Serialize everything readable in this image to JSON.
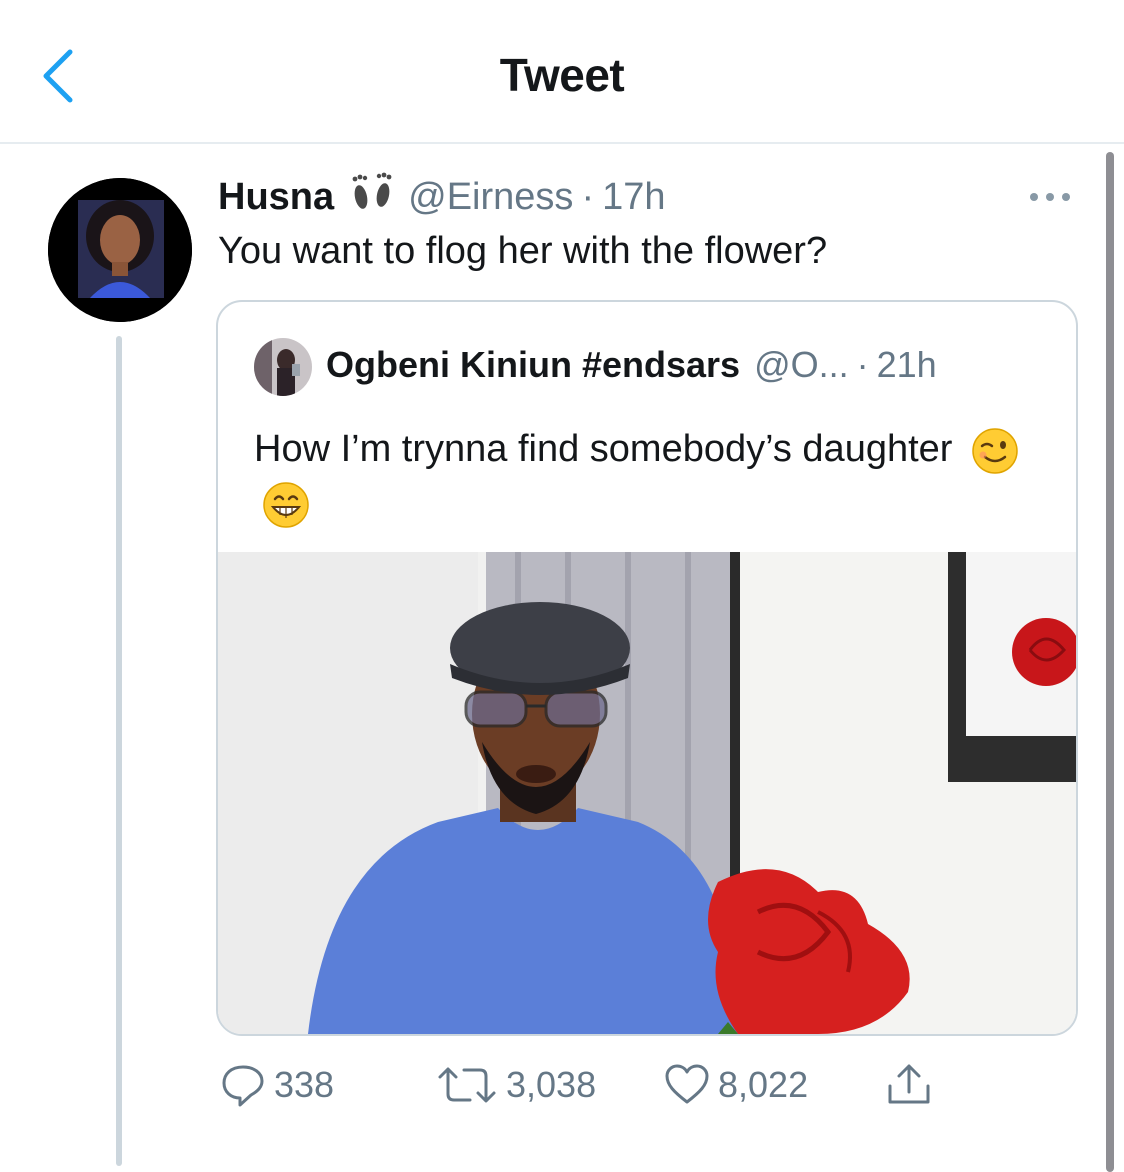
{
  "header": {
    "title": "Tweet"
  },
  "tweet": {
    "name": "Husna",
    "handle": "@Eirness",
    "separator": "·",
    "time": "17h",
    "text": "You want to flog her with the flower?",
    "name_emoji_icon": "footprints-icon"
  },
  "quote": {
    "name": "Ogbeni Kiniun #endsars",
    "handle": "@O...",
    "separator": "·",
    "time": "21h",
    "text": "How I’m trynna find somebody’s daughter",
    "emojis": [
      "winking-face-icon",
      "grinning-face-icon"
    ]
  },
  "actions": {
    "replies": "338",
    "retweets": "3,038",
    "likes": "8,022"
  },
  "colors": {
    "accent": "#1da1f2",
    "secondary_text": "#657786",
    "border": "#ccd6dd",
    "rose": "#d6201f",
    "sweater": "#5b7fd8"
  }
}
